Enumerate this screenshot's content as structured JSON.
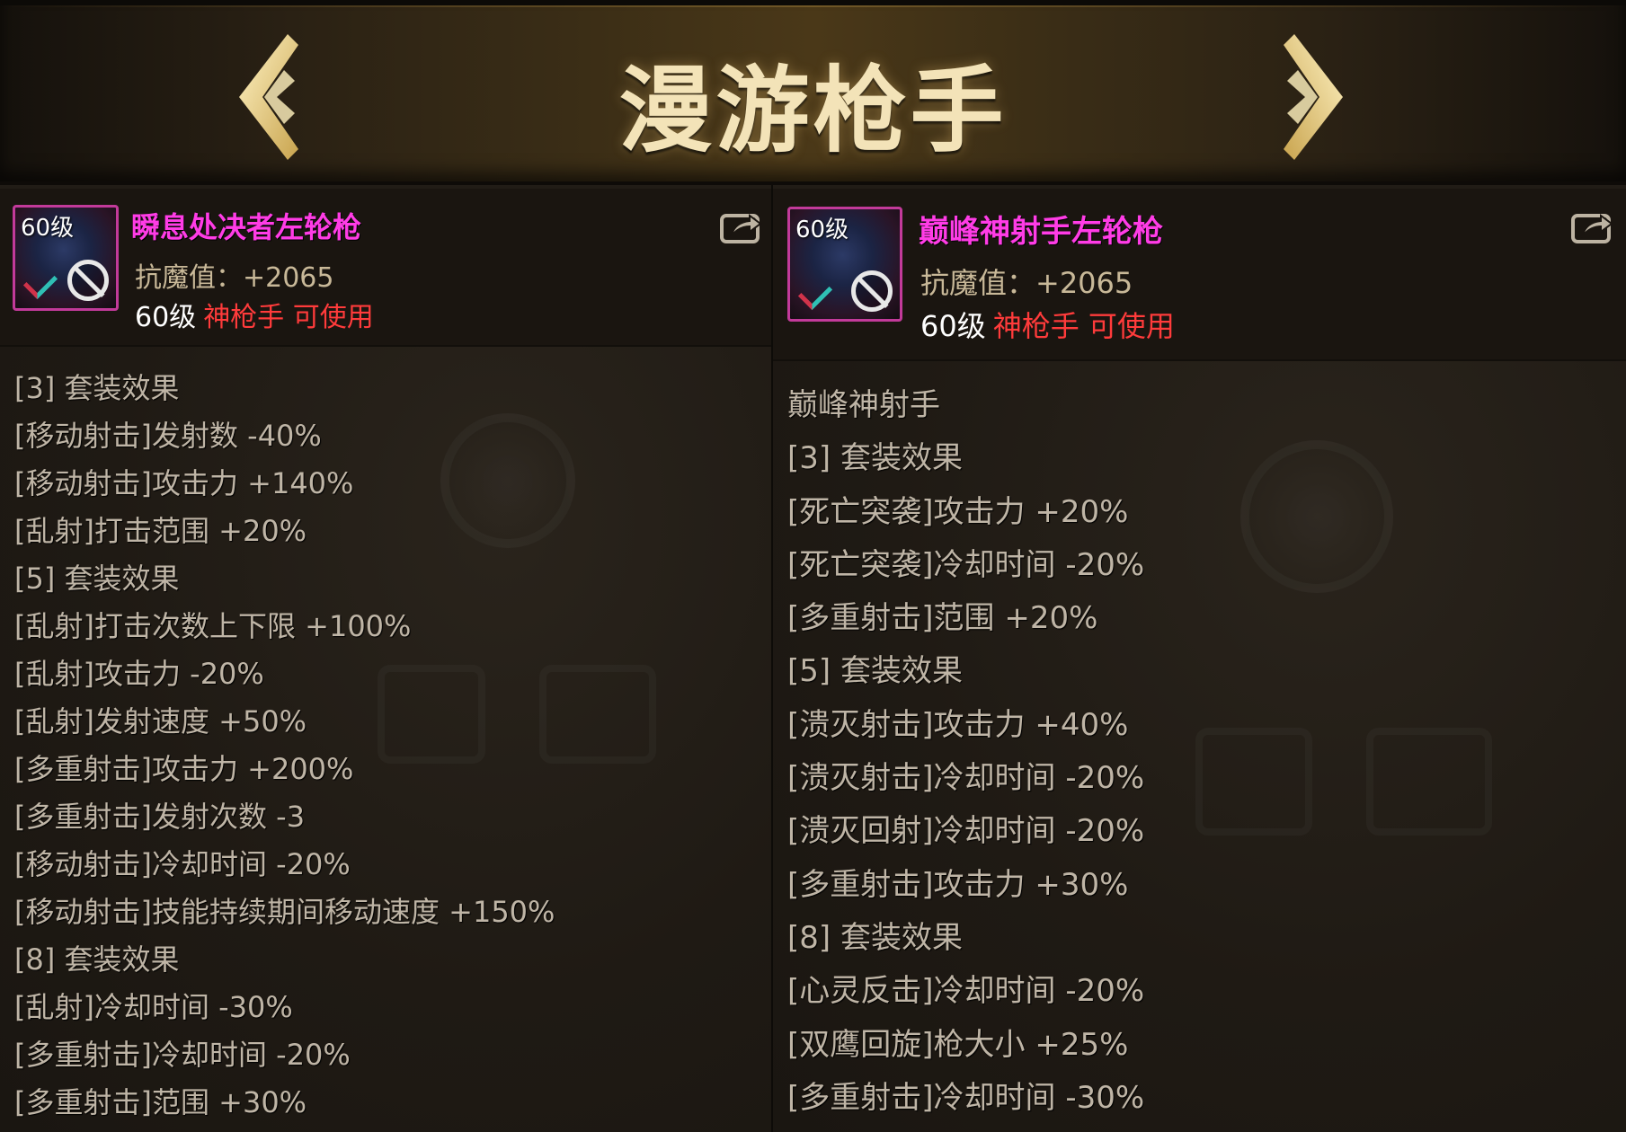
{
  "header": {
    "title": "漫游枪手",
    "prev_icon": "chevron-left-icon",
    "next_icon": "chevron-right-icon"
  },
  "left_item": {
    "level_badge": "60级",
    "name": "瞬息处决者左轮枪",
    "stat": "抗魔值：+2065",
    "req_level": "60级",
    "req_class": "神枪手 可使用",
    "effects": [
      "[3] 套装效果",
      "[移动射击]发射数 -40%",
      "[移动射击]攻击力 +140%",
      "[乱射]打击范围 +20%",
      "[5] 套装效果",
      "[乱射]打击次数上下限 +100%",
      "[乱射]攻击力 -20%",
      "[乱射]发射速度 +50%",
      "[多重射击]攻击力 +200%",
      "[多重射击]发射次数 -3",
      "[移动射击]冷却时间 -20%",
      "[移动射击]技能持续期间移动速度 +150%",
      "[8] 套装效果",
      "[乱射]冷却时间 -30%",
      "[多重射击]冷却时间 -20%",
      "[多重射击]范围 +30%"
    ]
  },
  "right_item": {
    "level_badge": "60级",
    "name": "巅峰神射手左轮枪",
    "stat": "抗魔值：+2065",
    "req_level": "60级",
    "req_class": "神枪手 可使用",
    "effects": [
      "巅峰神射手",
      "[3] 套装效果",
      "[死亡突袭]攻击力 +20%",
      "[死亡突袭]冷却时间 -20%",
      "[多重射击]范围 +20%",
      "[5] 套装效果",
      "[溃灭射击]攻击力 +40%",
      "[溃灭射击]冷却时间 -20%",
      "[溃灭回射]冷却时间 -20%",
      "[多重射击]攻击力 +30%",
      "[8] 套装效果",
      "[心灵反击]冷却时间 -20%",
      "[双鹰回旋]枪大小 +25%",
      "[多重射击]冷却时间 -30%"
    ]
  },
  "colors": {
    "item_name": "#ff3ce6",
    "class_req": "#ff3b3b",
    "icon_border": "#c23a9a",
    "title_gold": "#f3e3b8"
  }
}
